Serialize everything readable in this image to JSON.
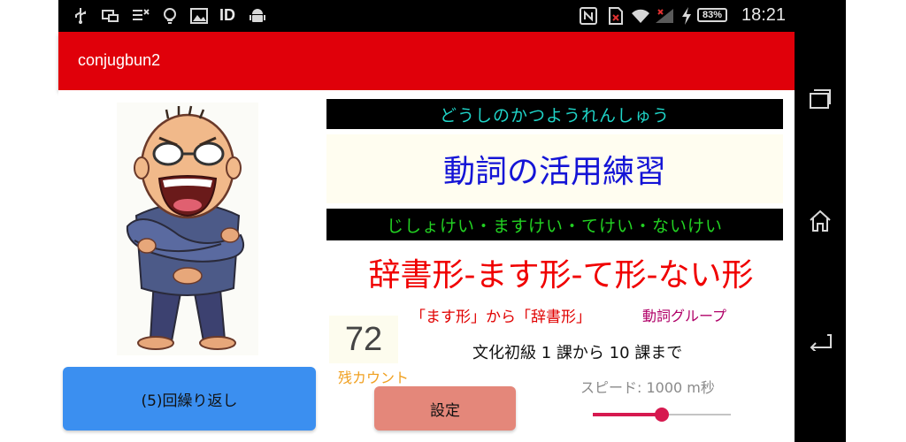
{
  "status_bar": {
    "battery": "83%",
    "time": "18:21",
    "id_label": "ID",
    "icons": [
      "usb-icon",
      "screen-cast-icon",
      "debug-icon",
      "bulb-icon",
      "image-icon",
      "android-icon",
      "nfc-icon",
      "sim-icon",
      "wifi-icon",
      "signal-icon",
      "charging-icon"
    ]
  },
  "app_bar": {
    "title": "conjugbun2"
  },
  "content": {
    "reading_title": "どうしのかつようれんしゅう",
    "main_title": "動詞の活用練習",
    "forms_reading": "じしょけい・ますけい・てけい・ないけい",
    "forms_title": "辞書形-ます形-て形-ない形",
    "direction": "「ます形」から「辞書形」",
    "group": "動詞グループ",
    "count": "72",
    "count_label": "残カウント",
    "range": "文化初級 1 課から 10 課まで",
    "speed_label": "スピード: 1000 m秒",
    "repeat_button": "(5)回繰り返し",
    "settings_button": "設定",
    "slider_level": 0.5
  },
  "colors": {
    "app_bar": "#e0000a",
    "reading_text": "#1fd4c8",
    "main_title": "#1414d6",
    "forms_reading": "#22d222",
    "forms_title": "#f00000",
    "repeat_button": "#3b8ff0",
    "settings_button": "#e4877a",
    "slider_accent": "#d6194f"
  },
  "nav_bar": {
    "icons": [
      "recents-icon",
      "home-icon",
      "back-icon"
    ]
  }
}
